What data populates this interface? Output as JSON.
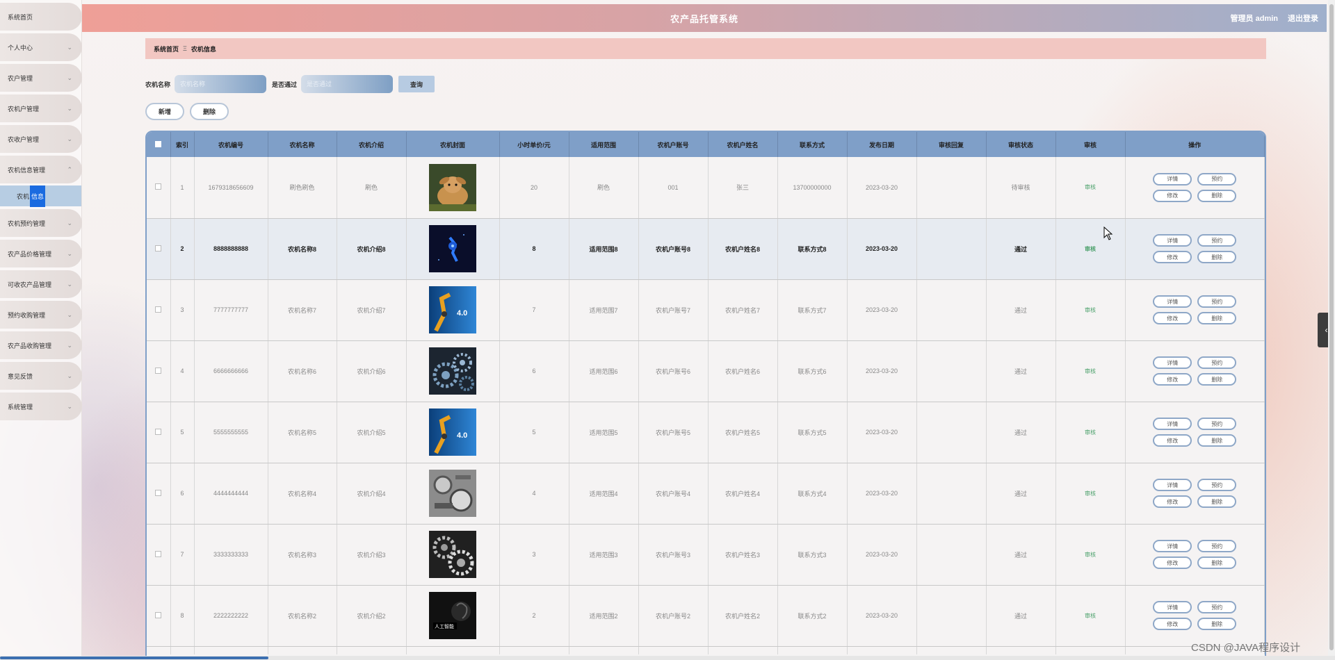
{
  "header": {
    "title": "农产品托管系统",
    "user": "管理员 admin",
    "logout": "退出登录"
  },
  "sidebar": {
    "items": [
      {
        "label": "系统首页",
        "chev": ""
      },
      {
        "label": "个人中心",
        "chev": "⌄"
      },
      {
        "label": "农户管理",
        "chev": "⌄"
      },
      {
        "label": "农机户管理",
        "chev": "⌄"
      },
      {
        "label": "农收户管理",
        "chev": "⌄"
      },
      {
        "label": "农机信息管理",
        "chev": "⌃"
      },
      {
        "label": "农机预约管理",
        "chev": "⌄"
      },
      {
        "label": "农产品价格管理",
        "chev": "⌄"
      },
      {
        "label": "可收农产品管理",
        "chev": "⌄"
      },
      {
        "label": "预约收购管理",
        "chev": "⌄"
      },
      {
        "label": "农产品收购管理",
        "chev": "⌄"
      },
      {
        "label": "意见反馈",
        "chev": "⌄"
      },
      {
        "label": "系统管理",
        "chev": "⌄"
      }
    ],
    "sub_item": {
      "prefix": "农机",
      "highlight": "信息"
    }
  },
  "breadcrumb": {
    "home": "系统首页",
    "sep": "Ξ",
    "current": "农机信息"
  },
  "search": {
    "name_label": "农机名称",
    "name_placeholder": "农机名称",
    "pass_label": "是否通过",
    "pass_placeholder": "是否通过",
    "search_button": "查询"
  },
  "actions": {
    "add": "新增",
    "delete": "删除"
  },
  "table": {
    "columns": [
      "",
      "索引",
      "农机编号",
      "农机名称",
      "农机介绍",
      "农机封面",
      "小时单价/元",
      "适用范围",
      "农机户账号",
      "农机户姓名",
      "联系方式",
      "发布日期",
      "审核回复",
      "审核状态",
      "审核",
      "操作"
    ],
    "rows": [
      {
        "index": "1",
        "code": "1679318656609",
        "name": "刷色刷色",
        "intro": "刷色",
        "cover": "rabbit",
        "price": "20",
        "scope": "刷色",
        "account": "001",
        "owner": "张三",
        "phone": "13700000000",
        "date": "2023-03-20",
        "reply": "",
        "status": "待审核",
        "audit": "审核"
      },
      {
        "index": "2",
        "code": "8888888888",
        "name": "农机名称8",
        "intro": "农机介绍8",
        "cover": "blue-tech",
        "price": "8",
        "scope": "适用范围8",
        "account": "农机户账号8",
        "owner": "农机户姓名8",
        "phone": "联系方式8",
        "date": "2023-03-20",
        "reply": "",
        "status": "通过",
        "audit": "审核"
      },
      {
        "index": "3",
        "code": "7777777777",
        "name": "农机名称7",
        "intro": "农机介绍7",
        "cover": "robot-arm",
        "price": "7",
        "scope": "适用范围7",
        "account": "农机户账号7",
        "owner": "农机户姓名7",
        "phone": "联系方式7",
        "date": "2023-03-20",
        "reply": "",
        "status": "通过",
        "audit": "审核"
      },
      {
        "index": "4",
        "code": "6666666666",
        "name": "农机名称6",
        "intro": "农机介绍6",
        "cover": "gears-blue",
        "price": "6",
        "scope": "适用范围6",
        "account": "农机户账号6",
        "owner": "农机户姓名6",
        "phone": "联系方式6",
        "date": "2023-03-20",
        "reply": "",
        "status": "通过",
        "audit": "审核"
      },
      {
        "index": "5",
        "code": "5555555555",
        "name": "农机名称5",
        "intro": "农机介绍5",
        "cover": "robot-arm",
        "price": "5",
        "scope": "适用范围5",
        "account": "农机户账号5",
        "owner": "农机户姓名5",
        "phone": "联系方式5",
        "date": "2023-03-20",
        "reply": "",
        "status": "通过",
        "audit": "审核"
      },
      {
        "index": "6",
        "code": "4444444444",
        "name": "农机名称4",
        "intro": "农机介绍4",
        "cover": "machinery",
        "price": "4",
        "scope": "适用范围4",
        "account": "农机户账号4",
        "owner": "农机户姓名4",
        "phone": "联系方式4",
        "date": "2023-03-20",
        "reply": "",
        "status": "通过",
        "audit": "审核"
      },
      {
        "index": "7",
        "code": "3333333333",
        "name": "农机名称3",
        "intro": "农机介绍3",
        "cover": "gears-gray",
        "price": "3",
        "scope": "适用范围3",
        "account": "农机户账号3",
        "owner": "农机户姓名3",
        "phone": "联系方式3",
        "date": "2023-03-20",
        "reply": "",
        "status": "通过",
        "audit": "审核"
      },
      {
        "index": "8",
        "code": "2222222222",
        "name": "农机名称2",
        "intro": "农机介绍2",
        "cover": "ai-dark",
        "price": "2",
        "scope": "适用范围2",
        "account": "农机户账号2",
        "owner": "农机户姓名2",
        "phone": "联系方式2",
        "date": "2023-03-20",
        "reply": "",
        "status": "通过",
        "audit": "审核"
      }
    ],
    "row_ops": [
      "详情",
      "预约",
      "修改",
      "删除"
    ],
    "cover_text": {
      "robot-arm": "ndu 4.0",
      "ai-dark": "人工智能"
    }
  },
  "watermark": "CSDN @JAVA程序设计"
}
